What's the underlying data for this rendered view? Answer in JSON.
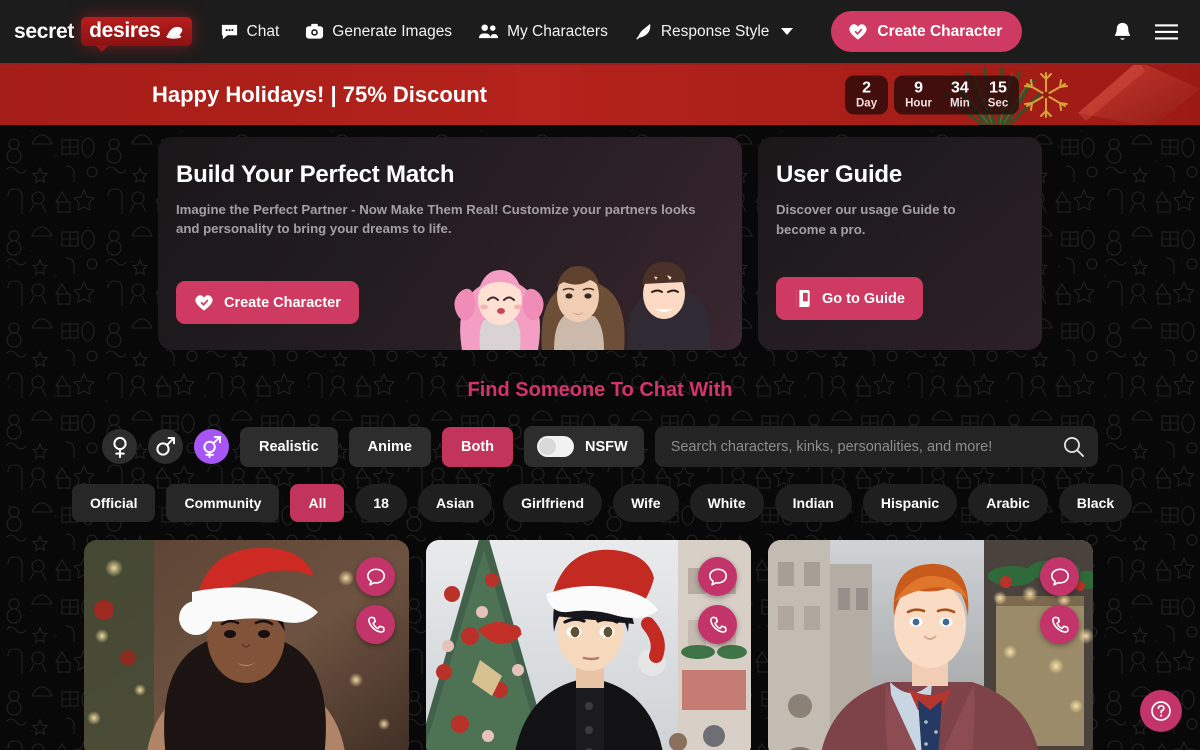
{
  "nav": {
    "logo_primary": "secret",
    "logo_accent": "desires",
    "links": [
      {
        "label": "Chat",
        "icon": "chat-bubble-icon"
      },
      {
        "label": "Generate Images",
        "icon": "camera-icon"
      },
      {
        "label": "My Characters",
        "icon": "users-icon"
      },
      {
        "label": "Response Style",
        "icon": "feather-icon",
        "has_caret": true
      }
    ],
    "create_button": "Create Character",
    "bell_icon": "bell-icon",
    "menu_icon": "hamburger-menu-icon"
  },
  "banner": {
    "title": "Happy Holidays! | 75% Discount",
    "countdown": [
      {
        "value": "2",
        "unit": "Day"
      },
      {
        "value": "9",
        "unit": "Hour"
      },
      {
        "value": "34",
        "unit": "Min"
      },
      {
        "value": "15",
        "unit": "Sec"
      }
    ]
  },
  "hero": {
    "title": "Build Your Perfect Match",
    "subtitle": "Imagine the Perfect Partner - Now Make Them Real! Customize your partners looks and personality to bring your dreams to life.",
    "button": "Create Character"
  },
  "guide": {
    "title": "User Guide",
    "subtitle": "Discover our usage Guide to become a pro.",
    "button": "Go to Guide"
  },
  "section": {
    "heading": "Find Someone To Chat With"
  },
  "filters": {
    "genders": [
      {
        "name": "female",
        "icon": "venus-icon",
        "active": false
      },
      {
        "name": "male",
        "icon": "mars-icon",
        "active": false
      },
      {
        "name": "both",
        "icon": "venus-mars-icon",
        "active": true
      }
    ],
    "styles": [
      {
        "label": "Realistic",
        "active": false
      },
      {
        "label": "Anime",
        "active": false
      },
      {
        "label": "Both",
        "active": true
      }
    ],
    "nsfw_label": "NSFW",
    "nsfw_on": false,
    "search_placeholder": "Search characters, kinks, personalities, and more!",
    "search_value": "",
    "search_icon": "search-icon"
  },
  "tags": [
    {
      "label": "Official",
      "shape": "square",
      "active": false
    },
    {
      "label": "Community",
      "shape": "square",
      "active": false
    },
    {
      "label": "All",
      "shape": "square",
      "active": true
    },
    {
      "label": "18",
      "shape": "round",
      "active": false
    },
    {
      "label": "Asian",
      "shape": "round",
      "active": false
    },
    {
      "label": "Girlfriend",
      "shape": "round",
      "active": false
    },
    {
      "label": "Wife",
      "shape": "round",
      "active": false
    },
    {
      "label": "White",
      "shape": "round",
      "active": false
    },
    {
      "label": "Indian",
      "shape": "round",
      "active": false
    },
    {
      "label": "Hispanic",
      "shape": "round",
      "active": false
    },
    {
      "label": "Arabic",
      "shape": "round",
      "active": false
    },
    {
      "label": "Black",
      "shape": "round",
      "active": false
    }
  ],
  "characters": [
    {
      "name": "card-1",
      "description": "Woman in red and white santa outfit with santa hat, christmas lights background",
      "chat_icon": "chat-bubble-icon",
      "call_icon": "phone-icon"
    },
    {
      "name": "card-2",
      "description": "Anime male with black hair, santa hat and black coat in front of a christmas tree",
      "chat_icon": "chat-bubble-icon",
      "call_icon": "phone-icon"
    },
    {
      "name": "card-3",
      "description": "Red haired man in maroon suit on a festive city street",
      "chat_icon": "chat-bubble-icon",
      "call_icon": "phone-icon"
    }
  ],
  "help": {
    "icon": "question-mark-icon",
    "label": "?"
  },
  "colors": {
    "accent_pink": "#cf3a63",
    "accent_crimson": "#c2345b",
    "banner_red": "#b4231c",
    "heading_pink": "#d6336c",
    "gender_active_purple": "#a855f7",
    "page_bg": "#080808"
  }
}
